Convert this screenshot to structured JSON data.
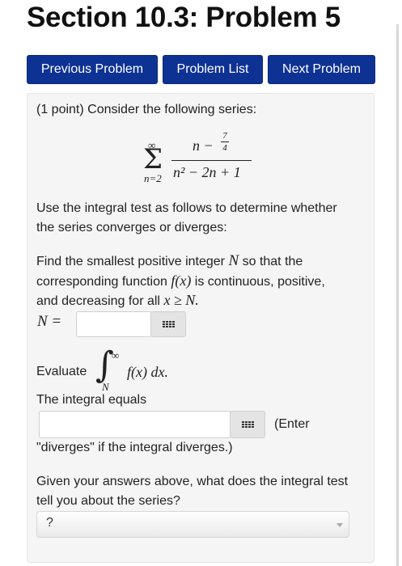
{
  "header": {
    "title": "Section 10.3: Problem 5"
  },
  "nav": {
    "previous_label": "Previous Problem",
    "list_label": "Problem List",
    "next_label": "Next Problem"
  },
  "problem": {
    "intro": "(1 point) Consider the following series:",
    "series": {
      "sum_upper": "∞",
      "sum_lower": "n=2",
      "numerator_var": "n −",
      "numerator_frac_num": "7",
      "numerator_frac_den": "4",
      "denominator": "n² − 2n + 1"
    },
    "instruction_line1": "Use the integral test as follows to determine whether",
    "instruction_line2": "the series converges or diverges:",
    "find": {
      "line1_a": "Find the smallest positive integer",
      "line1_var": "N",
      "line1_b": "so that the",
      "line2_a": "corresponding function",
      "line2_func": "f(x)",
      "line2_b": "is continuous, positive,",
      "line3_a": "and decreasing for all",
      "line3_expr": "x ≥ N."
    },
    "n_label": "N =",
    "n_input_value": "",
    "evaluate_label": "Evaluate",
    "integral": {
      "upper": "∞",
      "lower": "N",
      "integrand": "f(x) dx."
    },
    "integral_equals_label": "The integral equals",
    "integral_input_value": "",
    "enter_hint_a": "(Enter",
    "enter_hint_b": "\"diverges\" if the integral diverges.)",
    "question_line1": "Given your answers above, what does the integral test",
    "question_line2": "tell you about the series?",
    "select_value": "?"
  }
}
